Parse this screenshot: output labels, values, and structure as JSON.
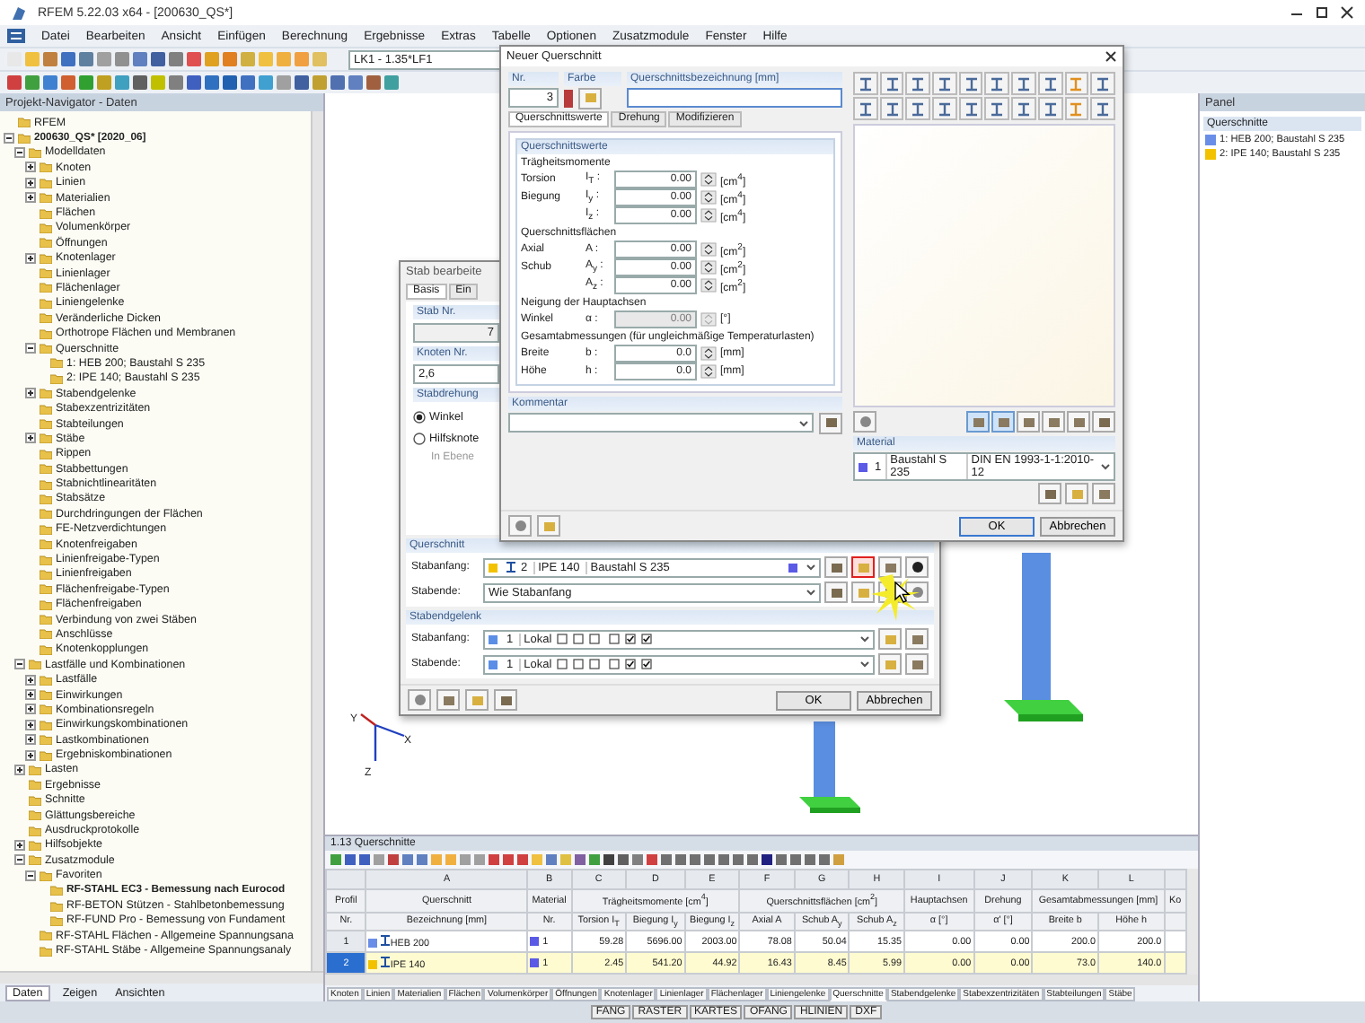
{
  "window": {
    "title": "RFEM 5.22.03 x64 - [200630_QS*]"
  },
  "menu": [
    "Datei",
    "Bearbeiten",
    "Ansicht",
    "Einfügen",
    "Berechnung",
    "Ergebnisse",
    "Extras",
    "Tabelle",
    "Optionen",
    "Zusatzmodule",
    "Fenster",
    "Hilfe"
  ],
  "toolbar": {
    "load_case": "LK1 - 1.35*LF1"
  },
  "navigator": {
    "title": "Projekt-Navigator - Daten",
    "tree": [
      {
        "label": "RFEM"
      },
      {
        "label": "200630_QS* [2020_06]",
        "bold": true,
        "expanded": true,
        "children": [
          {
            "label": "Modelldaten",
            "expanded": true,
            "children": [
              {
                "label": "Knoten",
                "expanded": false
              },
              {
                "label": "Linien",
                "expanded": false
              },
              {
                "label": "Materialien",
                "expanded": false
              },
              {
                "label": "Flächen"
              },
              {
                "label": "Volumenkörper"
              },
              {
                "label": "Öffnungen"
              },
              {
                "label": "Knotenlager",
                "expanded": false
              },
              {
                "label": "Linienlager"
              },
              {
                "label": "Flächenlager"
              },
              {
                "label": "Liniengelenke"
              },
              {
                "label": "Veränderliche Dicken"
              },
              {
                "label": "Orthotrope Flächen und Membranen"
              },
              {
                "label": "Querschnitte",
                "expanded": true,
                "children": [
                  {
                    "label": "1: HEB 200; Baustahl S 235"
                  },
                  {
                    "label": "2: IPE 140; Baustahl S 235"
                  }
                ]
              },
              {
                "label": "Stabendgelenke",
                "expanded": false
              },
              {
                "label": "Stabexzentrizitäten"
              },
              {
                "label": "Stabteilungen"
              },
              {
                "label": "Stäbe",
                "expanded": false
              },
              {
                "label": "Rippen"
              },
              {
                "label": "Stabbettungen"
              },
              {
                "label": "Stabnichtlinearitäten"
              },
              {
                "label": "Stabsätze"
              },
              {
                "label": "Durchdringungen der Flächen"
              },
              {
                "label": "FE-Netzverdichtungen"
              },
              {
                "label": "Knotenfreigaben"
              },
              {
                "label": "Linienfreigabe-Typen"
              },
              {
                "label": "Linienfreigaben"
              },
              {
                "label": "Flächenfreigabe-Typen"
              },
              {
                "label": "Flächenfreigaben"
              },
              {
                "label": "Verbindung von zwei Stäben"
              },
              {
                "label": "Anschlüsse"
              },
              {
                "label": "Knotenkopplungen"
              }
            ]
          },
          {
            "label": "Lastfälle und Kombinationen",
            "expanded": true,
            "children": [
              {
                "label": "Lastfälle",
                "expanded": false
              },
              {
                "label": "Einwirkungen",
                "expanded": false
              },
              {
                "label": "Kombinationsregeln",
                "expanded": false
              },
              {
                "label": "Einwirkungskombinationen",
                "expanded": false
              },
              {
                "label": "Lastkombinationen",
                "expanded": false
              },
              {
                "label": "Ergebniskombinationen",
                "expanded": false
              }
            ]
          },
          {
            "label": "Lasten",
            "expanded": false
          },
          {
            "label": "Ergebnisse"
          },
          {
            "label": "Schnitte"
          },
          {
            "label": "Glättungsbereiche"
          },
          {
            "label": "Ausdruckprotokolle"
          },
          {
            "label": "Hilfsobjekte",
            "expanded": false
          },
          {
            "label": "Zusatzmodule",
            "expanded": true,
            "children": [
              {
                "label": "Favoriten",
                "expanded": true,
                "children": [
                  {
                    "label": "RF-STAHL EC3 - Bemessung nach Eurocod",
                    "bold": true
                  },
                  {
                    "label": "RF-BETON Stützen - Stahlbetonbemessung"
                  },
                  {
                    "label": "RF-FUND Pro - Bemessung von Fundament"
                  }
                ]
              },
              {
                "label": "RF-STAHL Flächen - Allgemeine Spannungsana"
              },
              {
                "label": "RF-STAHL Stäbe - Allgemeine Spannungsanaly"
              }
            ]
          }
        ]
      }
    ],
    "tabs": [
      {
        "label": "Daten",
        "selected": true
      },
      {
        "label": "Zeigen",
        "selected": false
      },
      {
        "label": "Ansichten",
        "selected": false
      }
    ]
  },
  "viewport": {
    "axis_labels": [
      "X",
      "Y",
      "Z"
    ]
  },
  "panel": {
    "title": "Panel",
    "group": "Querschnitte",
    "items": [
      {
        "label": "1: HEB 200; Baustahl S 235",
        "color": "#6a8ee8"
      },
      {
        "label": "2: IPE 140; Baustahl S 235",
        "color": "#f2c200"
      }
    ]
  },
  "table": {
    "title": "1.13 Querschnitte",
    "groups": [
      {
        "text": "Profil",
        "columns": [
          {
            "label": "Nr."
          }
        ]
      },
      {
        "text": "Querschnitt",
        "columns": [
          {
            "letter": "A",
            "label": "Bezeichnung [mm]"
          }
        ]
      },
      {
        "text": "Material",
        "columns": [
          {
            "letter": "B",
            "label": "Nr."
          }
        ]
      },
      {
        "text": "Trägheitsmomente [cm$^{4}$]",
        "columns": [
          {
            "letter": "C",
            "label": "Torsion I$_{T}$"
          },
          {
            "letter": "D",
            "label": "Biegung I$_{y}$"
          },
          {
            "letter": "E",
            "label": "Biegung I$_{z}$"
          }
        ]
      },
      {
        "text": "Querschnittsflächen [cm$^{2}$]",
        "columns": [
          {
            "letter": "F",
            "label": "Axial A"
          },
          {
            "letter": "G",
            "label": "Schub A$_{y}$"
          },
          {
            "letter": "H",
            "label": "Schub A$_{z}$"
          }
        ]
      },
      {
        "text": "Hauptachsen",
        "columns": [
          {
            "letter": "I",
            "label": "α [°]"
          }
        ]
      },
      {
        "text": "Drehung",
        "columns": [
          {
            "letter": "J",
            "label": "α' [°]"
          }
        ]
      },
      {
        "text": "Gesamtabmessungen [mm]",
        "columns": [
          {
            "letter": "K",
            "label": "Breite b"
          },
          {
            "letter": "L",
            "label": "Höhe h"
          }
        ]
      },
      {
        "text": "Ko"
      }
    ],
    "rows": [
      {
        "no": "1",
        "selected": false,
        "color": "#6a8ee8",
        "name": "HEB 200",
        "material": "1",
        "values": [
          "59.28",
          "5696.00",
          "2003.00",
          "78.08",
          "50.04",
          "15.35",
          "0.00",
          "0.00",
          "200.0",
          "200.0"
        ]
      },
      {
        "no": "2",
        "selected": true,
        "color": "#f2c200",
        "name": "IPE 140",
        "material": "1",
        "values": [
          "2.45",
          "541.20",
          "44.92",
          "16.43",
          "8.45",
          "5.99",
          "0.00",
          "0.00",
          "73.0",
          "140.0"
        ]
      }
    ],
    "sheet_tabs": [
      {
        "label": "Knoten",
        "selected": false
      },
      {
        "label": "Linien",
        "selected": false
      },
      {
        "label": "Materialien",
        "selected": false
      },
      {
        "label": "Flächen",
        "selected": false
      },
      {
        "label": "Volumenkörper",
        "selected": false
      },
      {
        "label": "Öffnungen",
        "selected": false
      },
      {
        "label": "Knotenlager",
        "selected": false
      },
      {
        "label": "Linienlager",
        "selected": false
      },
      {
        "label": "Flächenlager",
        "selected": false
      },
      {
        "label": "Liniengelenke",
        "selected": false
      },
      {
        "label": "Querschnitte",
        "selected": true
      },
      {
        "label": "Stabendgelenke",
        "selected": false
      },
      {
        "label": "Stabexzentrizitäten",
        "selected": false
      },
      {
        "label": "Stabteilungen",
        "selected": false
      },
      {
        "label": "Stäbe",
        "selected": false
      }
    ]
  },
  "status_bar": [
    "FANG",
    "RASTER",
    "KARTES",
    "OFANG",
    "HLINIEN",
    "DXF"
  ],
  "member_dialog": {
    "title": "Stab bearbeite",
    "tabs": [
      {
        "label": "Basis",
        "selected": true
      },
      {
        "label": "Ein",
        "selected": false
      }
    ],
    "member_no": {
      "label": "Stab Nr.",
      "value": "7"
    },
    "nodes": {
      "label": "Knoten Nr.",
      "value": "2,6"
    },
    "rotation": {
      "label": "Stabdrehung",
      "options": [
        {
          "label": "Winkel",
          "selected": true
        },
        {
          "label": "Hilfsknote",
          "selected": false
        }
      ],
      "plane_label": "In Ebene"
    },
    "section": {
      "label": "Querschnitt",
      "start": {
        "label": "Stabanfang:",
        "color": "#f2c200",
        "no": "2",
        "name": "IPE 140",
        "material": "Baustahl S 235",
        "new_highlighted": true
      },
      "end": {
        "label": "Stabende:",
        "value": "Wie Stabanfang"
      }
    },
    "hinges": {
      "label": "Stabendgelenk",
      "rows": [
        {
          "label": "Stabanfang:",
          "color": "#5b8ee6",
          "no": "1",
          "system": "Lokal",
          "checks": [
            false,
            false,
            false,
            false,
            true,
            true
          ]
        },
        {
          "label": "Stabende:",
          "color": "#5b8ee6",
          "no": "1",
          "system": "Lokal",
          "checks": [
            false,
            false,
            false,
            false,
            true,
            true
          ]
        }
      ]
    },
    "buttons": [
      "OK",
      "Abbrechen"
    ]
  },
  "section_dialog": {
    "title": "Neuer Querschnitt",
    "no": {
      "label": "Nr.",
      "value": "3"
    },
    "color": {
      "label": "Farbe"
    },
    "designation": {
      "label": "Querschnittsbezeichnung [mm]"
    },
    "tabs": [
      {
        "label": "Querschnittswerte",
        "selected": true
      },
      {
        "label": "Drehung",
        "selected": false
      },
      {
        "label": "Modifizieren",
        "selected": false
      }
    ],
    "values_title": "Querschnittswerte",
    "sections": [
      {
        "title": "Trägheitsmomente",
        "rows": [
          {
            "label": "Torsion",
            "symbol": "I$_{T}$ :",
            "value": "0.00",
            "unit": "[cm$^{4}$]",
            "disabled": false
          },
          {
            "label": "Biegung",
            "symbol": "I$_{y}$ :",
            "value": "0.00",
            "unit": "[cm$^{4}$]",
            "disabled": false
          },
          {
            "symbol": "I$_{z}$ :",
            "value": "0.00",
            "unit": "[cm$^{4}$]",
            "disabled": false
          }
        ]
      },
      {
        "title": "Querschnittsflächen",
        "rows": [
          {
            "label": "Axial",
            "symbol": "A :",
            "value": "0.00",
            "unit": "[cm$^{2}$]",
            "disabled": false
          },
          {
            "label": "Schub",
            "symbol": "A$_{y}$ :",
            "value": "0.00",
            "unit": "[cm$^{2}$]",
            "disabled": false
          },
          {
            "symbol": "A$_{z}$ :",
            "value": "0.00",
            "unit": "[cm$^{2}$]",
            "disabled": false
          }
        ]
      },
      {
        "title": "Neigung der Hauptachsen",
        "rows": [
          {
            "label": "Winkel",
            "symbol": "α :",
            "value": "0.00",
            "unit": "[°]",
            "disabled": true
          }
        ]
      },
      {
        "title": "Gesamtabmessungen (für ungleichmäßige Temperaturlasten)",
        "rows": [
          {
            "label": "Breite",
            "symbol": "b :",
            "value": "0.0",
            "unit": "[mm]",
            "disabled": false
          },
          {
            "label": "Höhe",
            "symbol": "h :",
            "value": "0.0",
            "unit": "[mm]",
            "disabled": false
          }
        ]
      }
    ],
    "comment": {
      "label": "Kommentar"
    },
    "material": {
      "label": "Material",
      "color": "#5a5ae6",
      "no": "1",
      "name": "Baustahl S 235",
      "standard": "DIN EN 1993-1-1:2010-12"
    },
    "buttons": [
      "OK",
      "Abbrechen"
    ]
  }
}
